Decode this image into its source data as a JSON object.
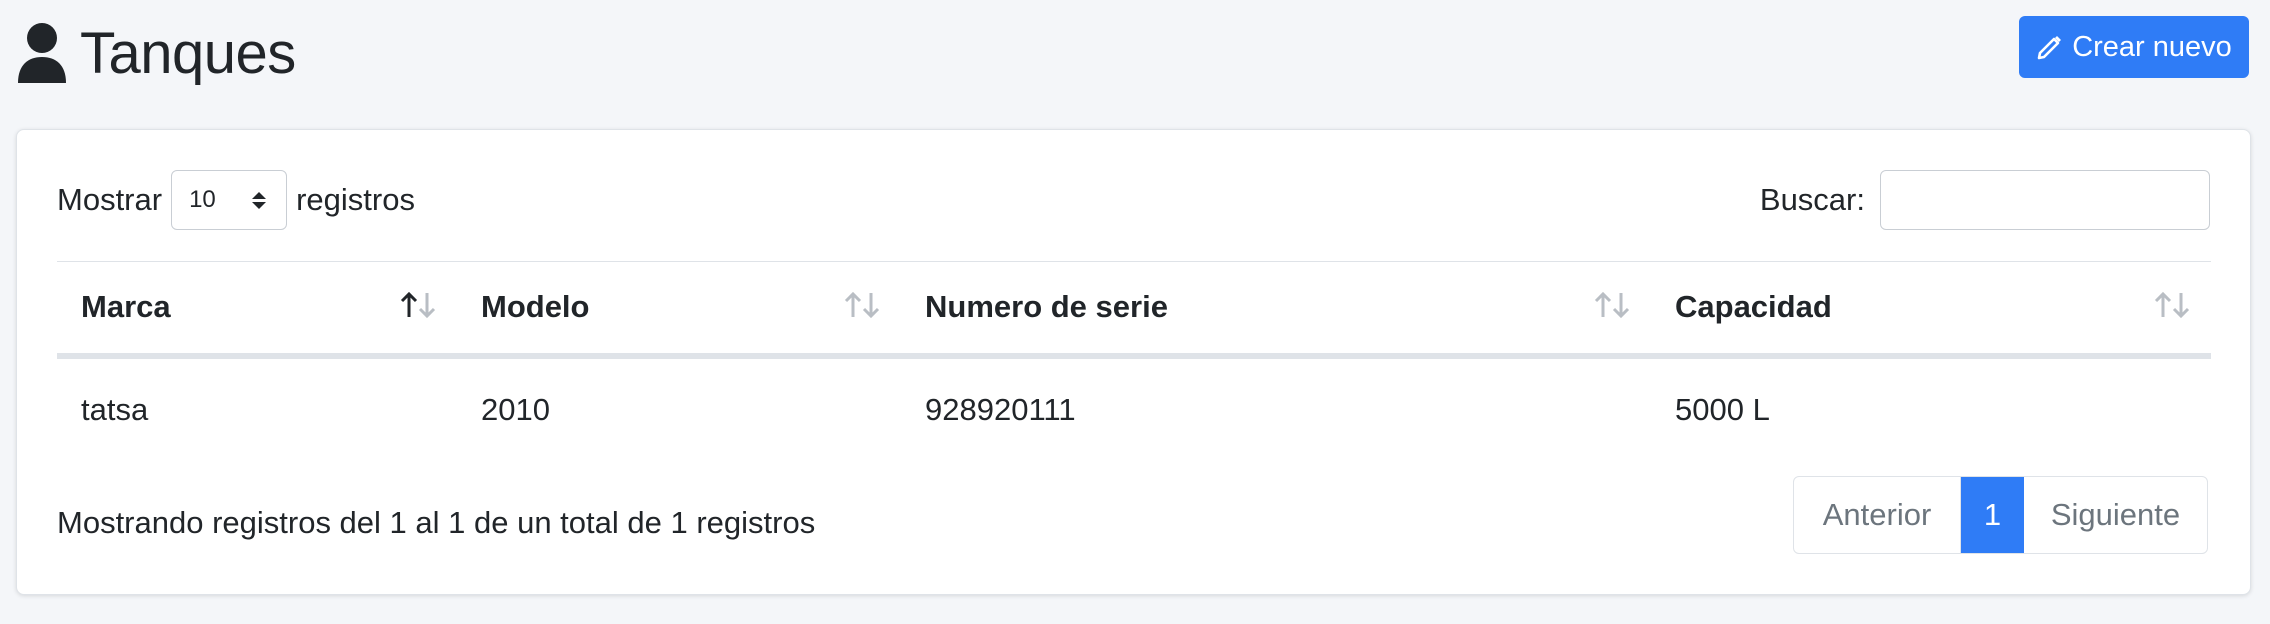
{
  "page": {
    "title": "Tanques",
    "create_button": "Crear nuevo"
  },
  "controls": {
    "show_label": "Mostrar",
    "page_size": "10",
    "records_label": "registros",
    "search_label": "Buscar:",
    "search_value": ""
  },
  "table": {
    "columns": [
      "Marca",
      "Modelo",
      "Numero de serie",
      "Capacidad"
    ],
    "rows": [
      [
        "tatsa",
        "2010",
        "928920111",
        "5000 L"
      ]
    ]
  },
  "footer": {
    "info": "Mostrando registros del 1 al 1 de un total de 1 registros",
    "prev": "Anterior",
    "current_page": "1",
    "next": "Siguiente"
  },
  "colors": {
    "accent": "#2f7cf6",
    "background": "#f4f6f9"
  },
  "icons": {
    "title": "user-icon",
    "create": "pencil-icon",
    "sort": "sort-arrows-icon"
  }
}
